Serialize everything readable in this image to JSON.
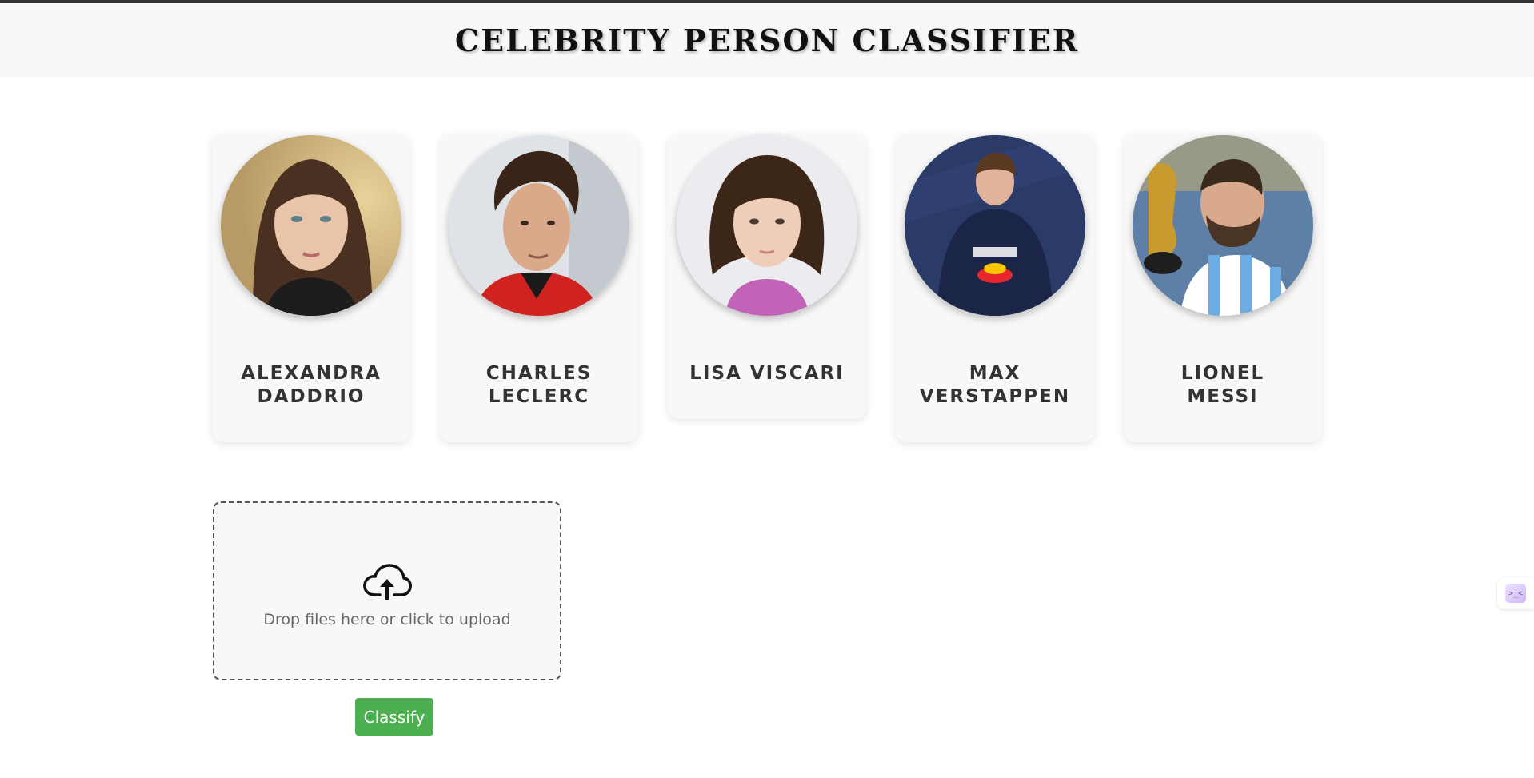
{
  "header": {
    "title": "CELEBRITY PERSON CLASSIFIER"
  },
  "celebrities": [
    {
      "name": "ALEXANDRA DADDRIO",
      "photo_icon": "portrait-photo"
    },
    {
      "name": "CHARLES LECLERC",
      "photo_icon": "portrait-photo"
    },
    {
      "name": "LISA VISCARI",
      "photo_icon": "portrait-photo"
    },
    {
      "name": "MAX VERSTAPPEN",
      "photo_icon": "portrait-photo"
    },
    {
      "name": "LIONEL MESSI",
      "photo_icon": "portrait-photo"
    }
  ],
  "upload": {
    "icon": "cloud-upload-icon",
    "text": "Drop files here or click to upload"
  },
  "classify": {
    "label": "Classify",
    "color": "#4caf50"
  },
  "side_widget": {
    "icon": "assistant-icon"
  }
}
